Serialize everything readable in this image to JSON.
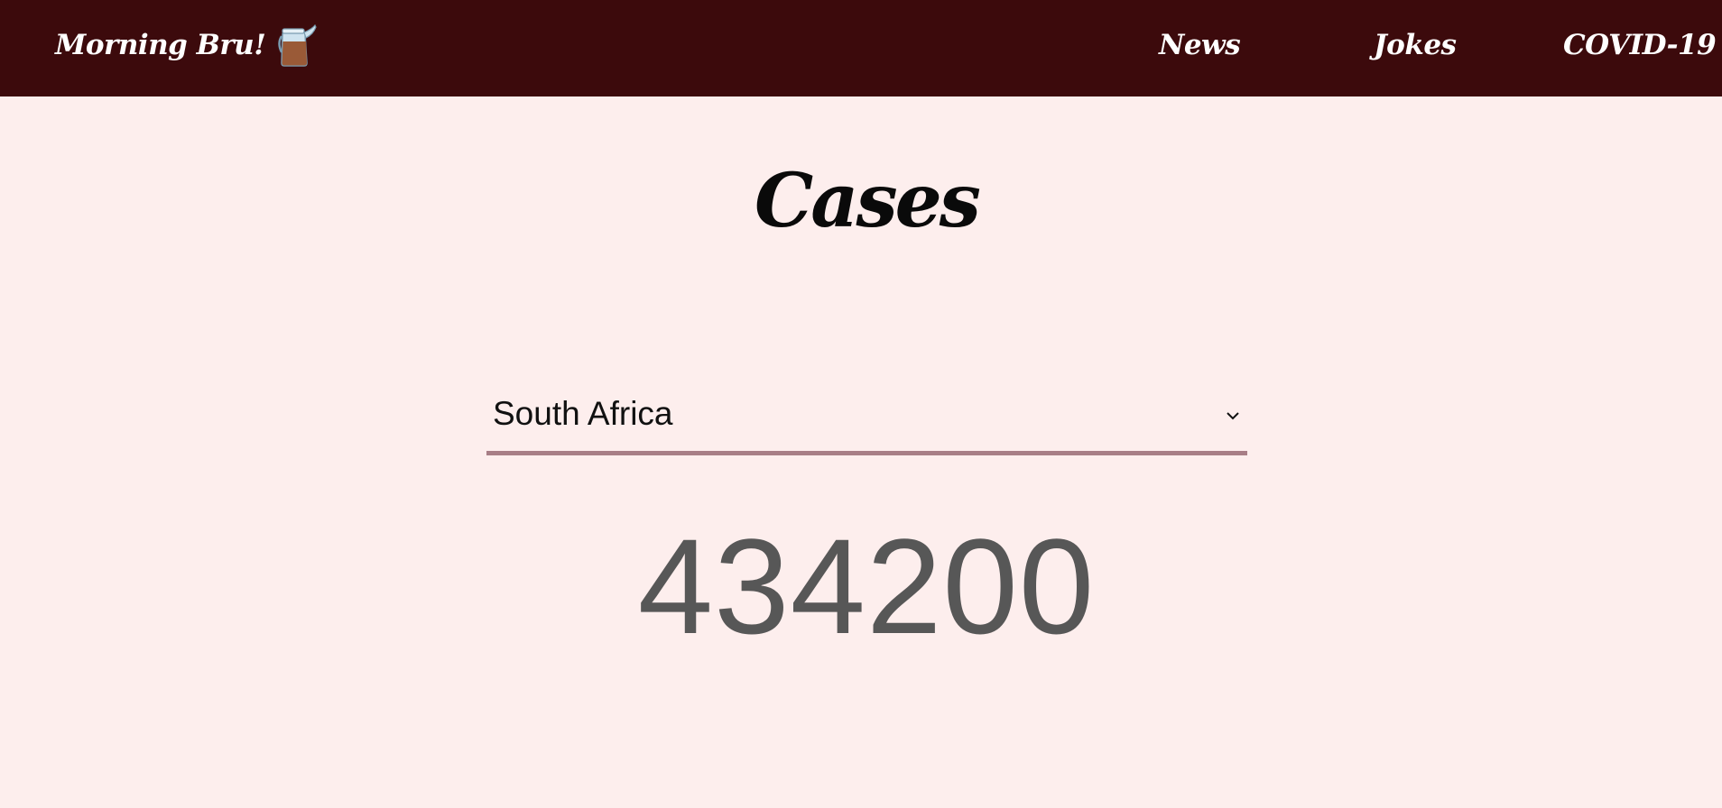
{
  "navbar": {
    "brand_label": "Morning Bru!",
    "brand_icon": "coffee-pot-icon",
    "links": [
      {
        "label": "News"
      },
      {
        "label": "Jokes"
      },
      {
        "label": "COVID-19"
      }
    ],
    "background": "#3c0a0c"
  },
  "main": {
    "title": "Cases",
    "country_select": {
      "selected": "South Africa",
      "icon": "chevron-down-icon"
    },
    "case_count": "434200"
  },
  "colors": {
    "page_background": "#fdeeed",
    "select_underline": "#a87e86",
    "count_text": "#575757"
  }
}
